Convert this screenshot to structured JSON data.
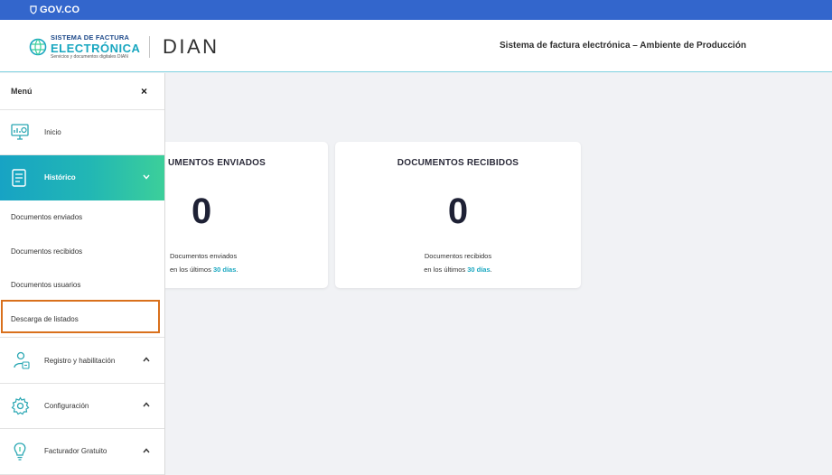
{
  "gov_bar": {
    "label": "GOV.CO"
  },
  "header": {
    "brand_line1": "SISTEMA DE FACTURA",
    "brand_line2": "ELECTRÓNICA",
    "brand_line3": "Servicios y documentos digitales DIAN",
    "dian_logo": "DIAN",
    "title": "Sistema de factura electrónica – Ambiente de Producción"
  },
  "sidebar": {
    "menu_title": "Menú",
    "close_icon": "×",
    "items": [
      {
        "label": "Inicio",
        "icon": "monitor-chart-icon"
      },
      {
        "label": "Histórico",
        "icon": "document-list-icon",
        "expanded": true
      },
      {
        "label": "Registro y habilitación",
        "icon": "user-register-icon",
        "expanded": false
      },
      {
        "label": "Configuración",
        "icon": "gear-icon",
        "expanded": false
      },
      {
        "label": "Facturador Gratuito",
        "icon": "lightbulb-icon",
        "expanded": false
      }
    ],
    "sub_items": [
      "Documentos enviados",
      "Documentos recibidos",
      "Documentos usuarios",
      "Descarga de listados"
    ]
  },
  "cards": [
    {
      "title": "UMENTOS ENVIADOS",
      "count": "0",
      "desc_line1": "Documentos enviados",
      "desc_prefix": "en los últimos ",
      "desc_days": "30 días",
      "desc_suffix": "."
    },
    {
      "title": "DOCUMENTOS RECIBIDOS",
      "count": "0",
      "desc_line1": "Documentos recibidos",
      "desc_prefix": "en los últimos ",
      "desc_days": "30 días",
      "desc_suffix": "."
    }
  ],
  "colors": {
    "gov_bar": "#3366cc",
    "accent": "#19a7c0",
    "active_gradient_start": "#17a3c4",
    "active_gradient_end": "#3ccf9a",
    "highlight_border": "#d9701c"
  }
}
